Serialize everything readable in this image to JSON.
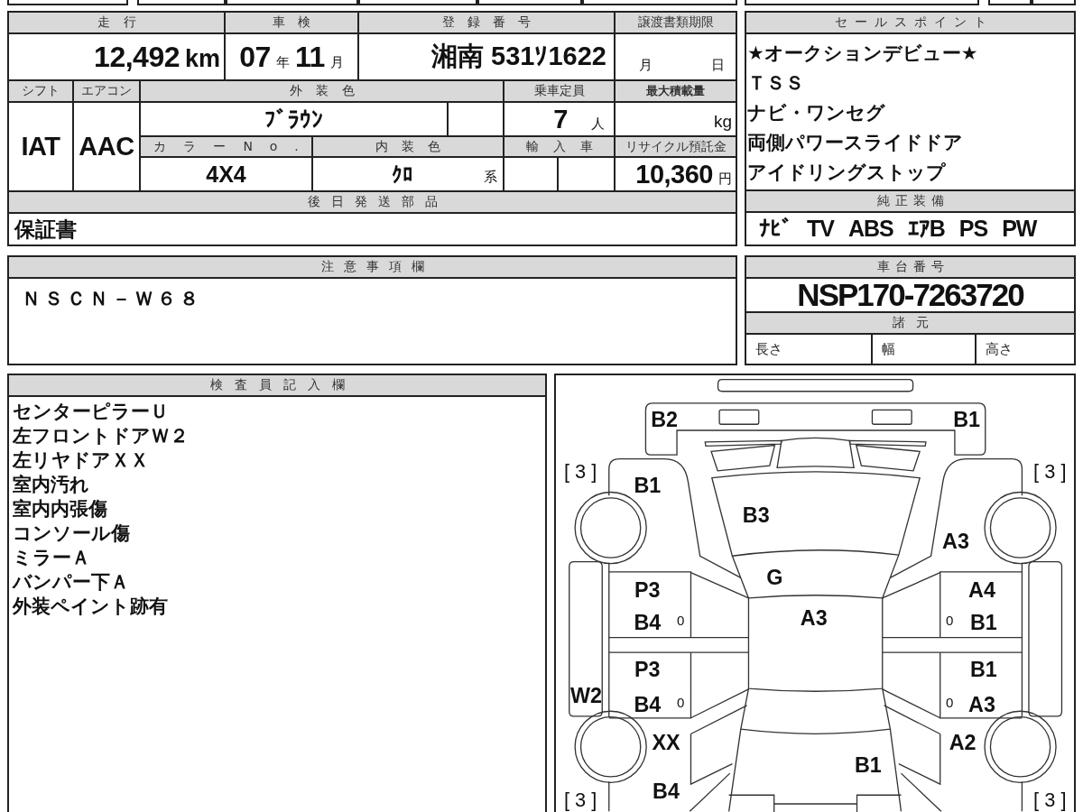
{
  "vehicle_table": {
    "mileage": {
      "label": "走行",
      "value": "12,492",
      "unit": "km"
    },
    "inspection": {
      "label": "車検",
      "year": "07",
      "year_unit": "年",
      "month": "11",
      "month_unit": "月"
    },
    "registration": {
      "label": "登録番号",
      "value": "湘南 531ｿ1622"
    },
    "transfer_deadline": {
      "label": "譲渡書類期限",
      "month_unit": "月",
      "day_unit": "日"
    },
    "shift": {
      "label": "シフト",
      "value": "IAT"
    },
    "air_conditioner": {
      "label": "エアコン",
      "value": "AAC"
    },
    "exterior_color": {
      "label": "外装色",
      "value": "ﾌﾞﾗｳﾝ"
    },
    "capacity": {
      "label": "乗車定員",
      "value": "7",
      "unit": "人"
    },
    "max_load": {
      "label": "最大積載量",
      "unit": "kg"
    },
    "color_no": {
      "label": "カラーNo.",
      "value": "4X4"
    },
    "interior_color": {
      "label": "内装色",
      "value": "ｸﾛ",
      "suffix": "系"
    },
    "import": {
      "label": "輸入車"
    },
    "recycle_fee": {
      "label": "リサイクル預託金",
      "value": "10,360",
      "unit": "円"
    },
    "later_parts": {
      "label": "後日発送部品",
      "value": "保証書"
    }
  },
  "sales_points": {
    "title": "セールスポイント",
    "lines": [
      "★オークションデビュー★",
      "ＴＳＳ",
      "ナビ・ワンセグ",
      "両側パワースライドドア",
      "アイドリングストップ"
    ]
  },
  "equipment": {
    "title": "純正装備",
    "items": [
      "ﾅﾋﾞ",
      "TV",
      "ABS",
      "ｴｱB",
      "PS",
      "PW"
    ]
  },
  "notes": {
    "title": "注意事項欄",
    "text": "ＮＳＣＮ－Ｗ６８"
  },
  "chassis": {
    "title": "車台番号",
    "number": "NSP170-7263720",
    "specs_title": "諸元",
    "specs": [
      "長さ",
      "幅",
      "高さ"
    ]
  },
  "inspector": {
    "title": "検査員記入欄",
    "lines": [
      "センターピラーＵ",
      "左フロントドアＷ２",
      "左リヤドアＸＸ",
      "室内汚れ",
      "室内内張傷",
      "コンソール傷",
      "ミラーＡ",
      "バンパー下Ａ",
      "外装ペイント跡有"
    ]
  },
  "diagram": {
    "marks": [
      {
        "kind": "code",
        "text": "B2"
      },
      {
        "kind": "code",
        "text": "B1"
      },
      {
        "kind": "bracketed",
        "text": "[ 3 ]"
      },
      {
        "kind": "bracketed",
        "text": "[ 3 ]"
      },
      {
        "kind": "code",
        "text": "B1"
      },
      {
        "kind": "code",
        "text": "B3"
      },
      {
        "kind": "code",
        "text": "A3"
      },
      {
        "kind": "code",
        "text": "G"
      },
      {
        "kind": "code",
        "text": "P3"
      },
      {
        "kind": "code",
        "text": "A4"
      },
      {
        "kind": "code",
        "text": "B4"
      },
      {
        "kind": "small",
        "text": "0"
      },
      {
        "kind": "code",
        "text": "A3"
      },
      {
        "kind": "small",
        "text": "0"
      },
      {
        "kind": "code",
        "text": "B1"
      },
      {
        "kind": "code",
        "text": "P3"
      },
      {
        "kind": "code",
        "text": "B1"
      },
      {
        "kind": "code",
        "text": "W2"
      },
      {
        "kind": "code",
        "text": "B4"
      },
      {
        "kind": "small",
        "text": "0"
      },
      {
        "kind": "small",
        "text": "0"
      },
      {
        "kind": "code",
        "text": "A3"
      },
      {
        "kind": "code",
        "text": "XX"
      },
      {
        "kind": "code",
        "text": "A2"
      },
      {
        "kind": "code",
        "text": "B1"
      },
      {
        "kind": "code",
        "text": "B4"
      },
      {
        "kind": "bracketed",
        "text": "[ 3 ]"
      },
      {
        "kind": "bracketed",
        "text": "[ 3 ]"
      }
    ]
  }
}
